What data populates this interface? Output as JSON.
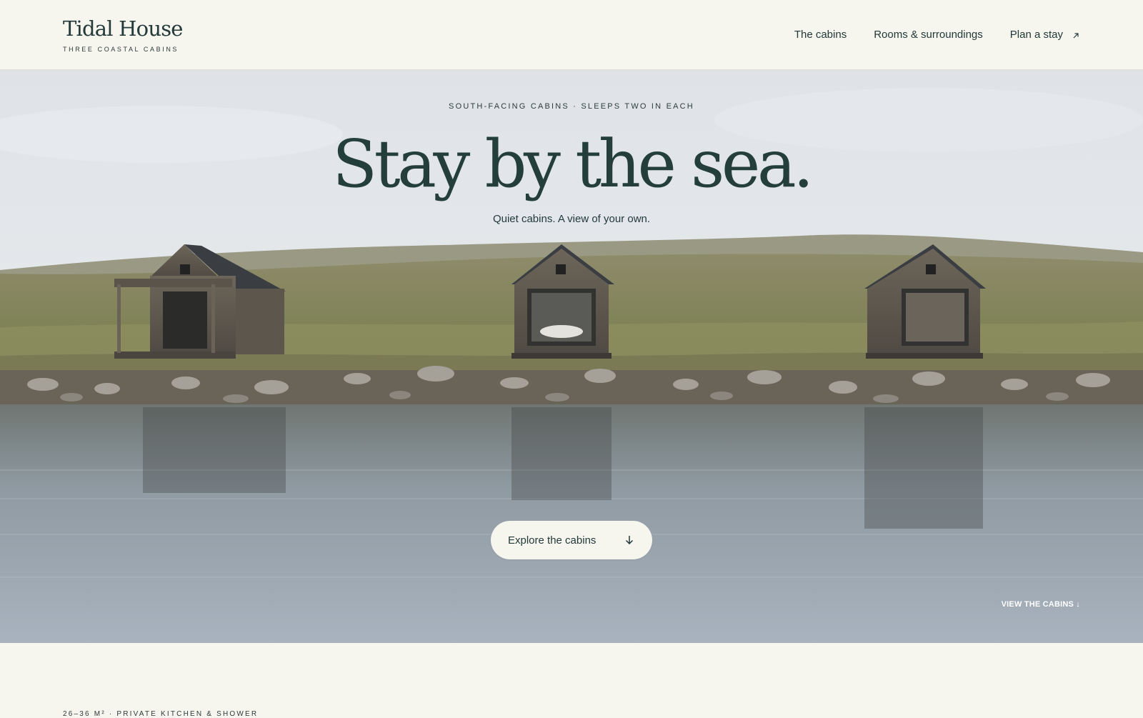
{
  "header": {
    "brand_name": "Tidal House",
    "brand_tagline": "THREE COASTAL CABINS",
    "nav": [
      {
        "label": "The cabins"
      },
      {
        "label": "Rooms & surroundings"
      },
      {
        "label": "Plan a stay",
        "icon": "arrow-up-right-icon"
      }
    ]
  },
  "hero": {
    "eyebrow": "SOUTH-FACING CABINS · SLEEPS TWO IN EACH",
    "headline": "Stay by the sea.",
    "subhead": "Quiet cabins. A view of your own.",
    "cta_label": "Explore the cabins",
    "cta_icon": "arrow-down-icon",
    "corner_link": "VIEW THE CABINS ↓",
    "image": "three-wooden-cabins-by-coastal-water-photo"
  },
  "below": {
    "meta": "26–36 M² · PRIVATE KITCHEN & SHOWER"
  },
  "colors": {
    "background": "#f6f5ee",
    "ink": "#23393a",
    "headline": "#243e3b"
  }
}
